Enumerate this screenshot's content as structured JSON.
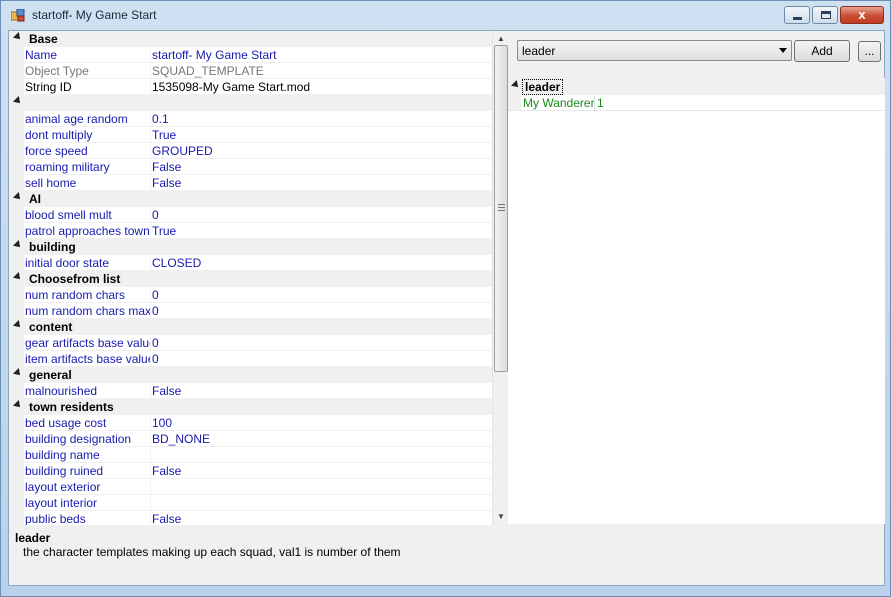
{
  "window": {
    "title": "startoff- My Game Start",
    "close_label": "x"
  },
  "grid": {
    "categories": [
      {
        "label": "Base",
        "props": [
          {
            "name": "Name",
            "value": "startoff- My Game Start"
          },
          {
            "name": "Object Type",
            "value": "SQUAD_TEMPLATE"
          },
          {
            "name": "String ID",
            "value": "1535098-My Game Start.mod"
          }
        ]
      },
      {
        "label": "",
        "props": [
          {
            "name": "animal age random",
            "value": "0.1"
          },
          {
            "name": "dont multiply",
            "value": "True"
          },
          {
            "name": "force speed",
            "value": "GROUPED"
          },
          {
            "name": "roaming military",
            "value": "False"
          },
          {
            "name": "sell home",
            "value": "False"
          }
        ]
      },
      {
        "label": "AI",
        "props": [
          {
            "name": "blood smell mult",
            "value": "0"
          },
          {
            "name": "patrol approaches towns",
            "value": "True"
          }
        ]
      },
      {
        "label": "building",
        "props": [
          {
            "name": "initial door state",
            "value": "CLOSED"
          }
        ]
      },
      {
        "label": "Choosefrom list",
        "props": [
          {
            "name": "num random chars",
            "value": "0"
          },
          {
            "name": "num random chars max",
            "value": "0"
          }
        ]
      },
      {
        "label": "content",
        "props": [
          {
            "name": "gear artifacts base value",
            "value": "0"
          },
          {
            "name": "item artifacts base value",
            "value": "0"
          }
        ]
      },
      {
        "label": "general",
        "props": [
          {
            "name": "malnourished",
            "value": "False"
          }
        ]
      },
      {
        "label": "town residents",
        "props": [
          {
            "name": "bed usage cost",
            "value": "100"
          },
          {
            "name": "building designation",
            "value": "BD_NONE"
          },
          {
            "name": "building name",
            "value": ""
          },
          {
            "name": "building ruined",
            "value": "False"
          },
          {
            "name": "layout exterior",
            "value": ""
          },
          {
            "name": "layout interior",
            "value": ""
          },
          {
            "name": "public beds",
            "value": "False"
          }
        ]
      }
    ]
  },
  "help": {
    "title": "leader",
    "description": "the character templates making up each squad, val1 is number of them"
  },
  "right": {
    "combo_value": "leader",
    "add_label": "Add",
    "more_label": "...",
    "tree_header": "leader",
    "tree_items": [
      {
        "name": "My Wanderer",
        "value": "1"
      }
    ]
  },
  "colors": {
    "prop_text": "#1a1ab0",
    "tree_text": "#1a8a1a",
    "category_bg": "#f0f0f0"
  }
}
